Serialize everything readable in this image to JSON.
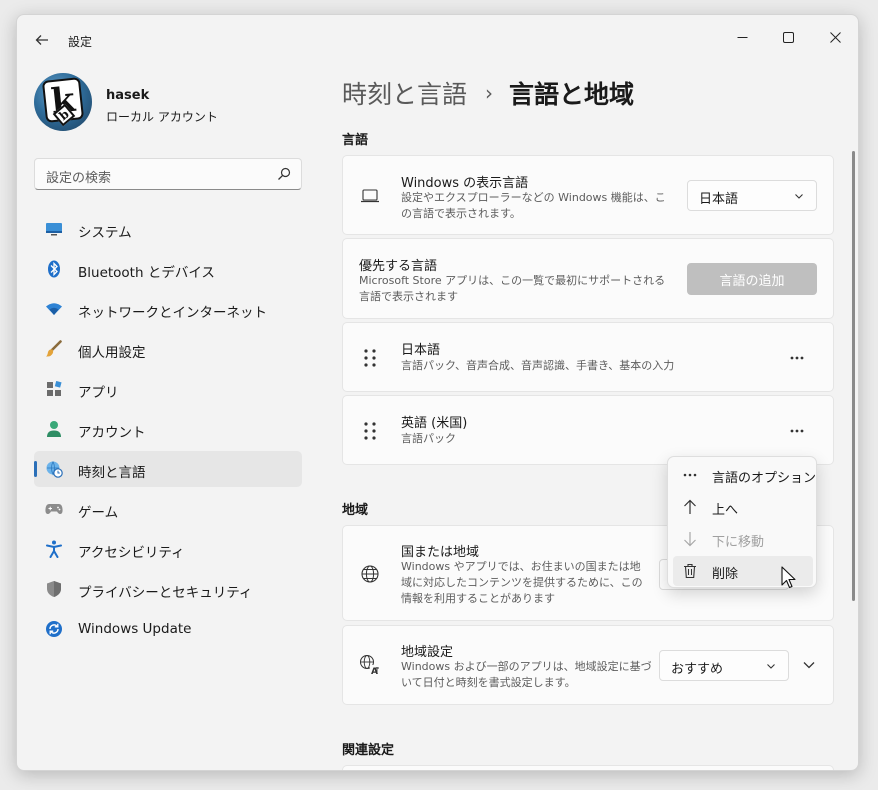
{
  "window": {
    "title": "設定"
  },
  "user": {
    "name": "hasek",
    "account_type": "ローカル アカウント"
  },
  "search": {
    "placeholder": "設定の検索"
  },
  "nav": {
    "items": [
      {
        "label": "システム",
        "icon": "monitor-icon"
      },
      {
        "label": "Bluetooth とデバイス",
        "icon": "bluetooth-icon"
      },
      {
        "label": "ネットワークとインターネット",
        "icon": "wifi-icon"
      },
      {
        "label": "個人用設定",
        "icon": "brush-icon"
      },
      {
        "label": "アプリ",
        "icon": "apps-icon"
      },
      {
        "label": "アカウント",
        "icon": "person-icon"
      },
      {
        "label": "時刻と言語",
        "icon": "globe-clock-icon",
        "selected": true
      },
      {
        "label": "ゲーム",
        "icon": "gamepad-icon"
      },
      {
        "label": "アクセシビリティ",
        "icon": "accessibility-icon"
      },
      {
        "label": "プライバシーとセキュリティ",
        "icon": "shield-icon"
      },
      {
        "label": "Windows Update",
        "icon": "update-icon"
      }
    ]
  },
  "breadcrumb": {
    "parent": "時刻と言語",
    "separator": "›",
    "current": "言語と地域"
  },
  "language_section": {
    "title": "言語",
    "display_language": {
      "title": "Windows の表示言語",
      "description": "設定やエクスプローラーなどの Windows 機能は、この言語で表示されます。",
      "value": "日本語"
    },
    "preferred": {
      "title": "優先する言語",
      "description": "Microsoft Store アプリは、この一覧で最初にサポートされる言語で表示されます",
      "button": "言語の追加"
    },
    "languages": [
      {
        "name": "日本語",
        "features": "言語パック、音声合成、音声認識、手書き、基本の入力"
      },
      {
        "name": "英語 (米国)",
        "features": "言語パック"
      }
    ]
  },
  "context_menu": {
    "items": [
      {
        "label": "言語のオプション",
        "icon": "more-icon",
        "enabled": true
      },
      {
        "label": "上へ",
        "icon": "arrow-up-icon",
        "enabled": true
      },
      {
        "label": "下に移動",
        "icon": "arrow-down-icon",
        "enabled": false
      },
      {
        "label": "削除",
        "icon": "trash-icon",
        "enabled": true,
        "hovered": true
      }
    ]
  },
  "region_section": {
    "title": "地域",
    "country": {
      "title": "国または地域",
      "description": "Windows やアプリでは、お住まいの国または地域に対応したコンテンツを提供するために、この情報を利用することがあります"
    },
    "format": {
      "title": "地域設定",
      "description": "Windows および一部のアプリは、地域設定に基づいて日付と時刻を書式設定します。",
      "value": "おすすめ"
    }
  },
  "related_section": {
    "title": "関連設定"
  },
  "colors": {
    "accent": "#2a6fb8",
    "selected_nav": "#e6e6e6",
    "disabled_button": "#bfbfbf"
  }
}
